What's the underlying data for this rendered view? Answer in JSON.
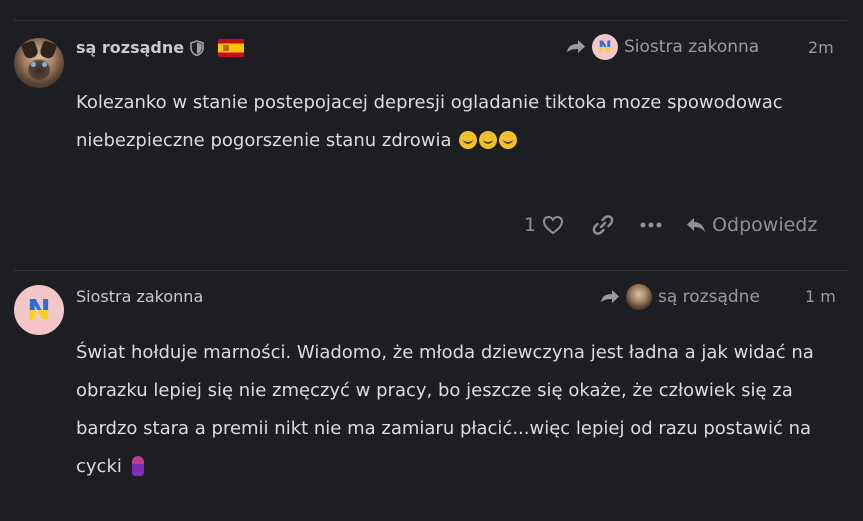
{
  "posts": [
    {
      "author": "są rozsądne",
      "reply_to": "Siostra zakonna",
      "time": "2m",
      "body_text": "Kolezanko w stanie postepojacej depresji ogladanie tiktoka moze spowodowac niebezpieczne pogorszenie stanu zdrowia",
      "emojis": [
        "cat-grin-emoji",
        "cat-grin-emoji",
        "cat-grin-emoji"
      ],
      "like_count": "1",
      "reply_label": "Odpowiedz",
      "flag": "spain-flag-icon"
    },
    {
      "author": "Siostra zakonna",
      "reply_to": "są rozsądne",
      "time": "1 m",
      "body_text": "Świat hołduje marności. Wiadomo, że młoda dziewczyna jest ładna a jak widać na obrazku lepiej się nie zmęczyć w pracy, bo jeszcze się okaże, że człowiek się za bardzo stara a premii nikt nie ma zamiaru płacić...więc lepiej od razu postawić na cycki",
      "emojis": [
        "doll-emoji"
      ]
    }
  ],
  "colors": {
    "background": "#1d1e22",
    "text": "#dcdcdc",
    "muted": "#9a9aa0",
    "divider": "#34353b"
  }
}
